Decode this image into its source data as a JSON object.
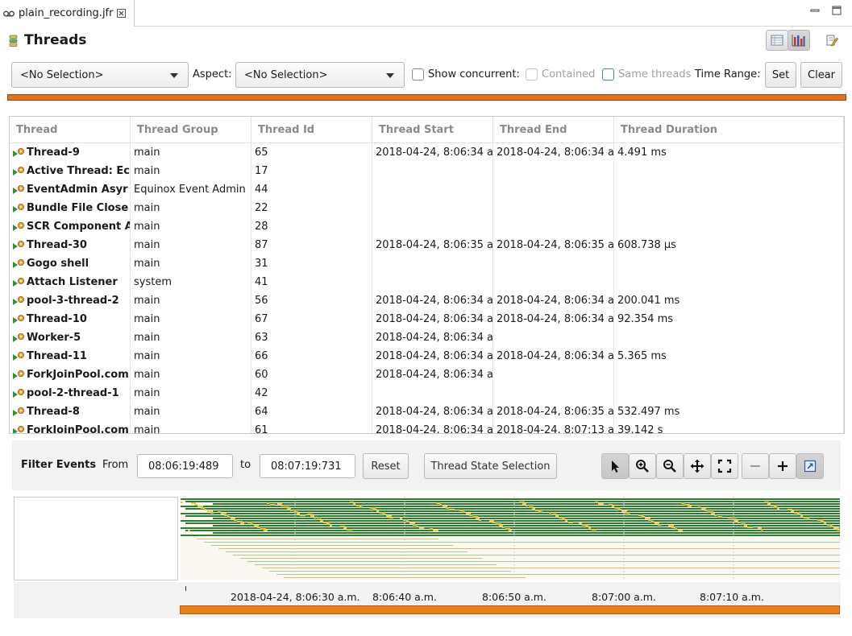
{
  "editor_tab": {
    "title": "plain_recording.jfr"
  },
  "page": {
    "title": "Threads"
  },
  "toolbar": {
    "selection_combo": "<No Selection>",
    "aspect_label": "Aspect:",
    "aspect_combo": "<No Selection>",
    "show_concurrent_label": "Show concurrent:",
    "contained_label": "Contained",
    "same_threads_label": "Same threads",
    "time_range_label": "Time Range:",
    "set_button": "Set",
    "clear_button": "Clear"
  },
  "table": {
    "columns": [
      "Thread",
      "Thread Group",
      "Thread Id",
      "Thread Start",
      "Thread End",
      "Thread Duration"
    ],
    "rows": [
      [
        "Thread-9",
        "main",
        "65",
        "2018-04-24, 8:06:34 a",
        "2018-04-24, 8:06:34 a",
        "4.491  ms"
      ],
      [
        "Active Thread: Ec",
        "main",
        "17",
        "",
        "",
        ""
      ],
      [
        "EventAdmin Asyr",
        "Equinox Event Admin",
        "44",
        "",
        "",
        ""
      ],
      [
        "Bundle File Close",
        "main",
        "22",
        "",
        "",
        ""
      ],
      [
        "SCR Component A",
        "main",
        "28",
        "",
        "",
        ""
      ],
      [
        "Thread-30",
        "main",
        "87",
        "2018-04-24, 8:06:35 a",
        "2018-04-24, 8:06:35 a",
        "608.738  µs"
      ],
      [
        "Gogo shell",
        "main",
        "31",
        "",
        "",
        ""
      ],
      [
        "Attach Listener",
        "system",
        "41",
        "",
        "",
        ""
      ],
      [
        "pool-3-thread-2",
        "main",
        "56",
        "2018-04-24, 8:06:34 a",
        "2018-04-24, 8:06:34 a",
        "200.041  ms"
      ],
      [
        "Thread-10",
        "main",
        "67",
        "2018-04-24, 8:06:34 a",
        "2018-04-24, 8:06:34 a",
        "92.354  ms"
      ],
      [
        "Worker-5",
        "main",
        "63",
        "2018-04-24, 8:06:34 a",
        "",
        ""
      ],
      [
        "Thread-11",
        "main",
        "66",
        "2018-04-24, 8:06:34 a",
        "2018-04-24, 8:06:34 a",
        "5.365  ms"
      ],
      [
        "ForkJoinPool.com",
        "main",
        "60",
        "2018-04-24, 8:06:34 a",
        "",
        ""
      ],
      [
        "pool-2-thread-1",
        "main",
        "42",
        "",
        "",
        ""
      ],
      [
        "Thread-8",
        "main",
        "64",
        "2018-04-24, 8:06:34 a",
        "2018-04-24, 8:06:35 a",
        "532.497  ms"
      ],
      [
        "ForkJoinPool.com",
        "main",
        "61",
        "2018-04-24, 8:06:34 a",
        "2018-04-24, 8:07:13 a",
        "39.142  s"
      ]
    ]
  },
  "filter": {
    "label": "Filter Events",
    "from_label": "From",
    "from_value": "08:06:19:489",
    "to_label": "to",
    "to_value": "08:07:19:731",
    "reset_button": "Reset",
    "thread_state_button": "Thread State Selection"
  },
  "tools": [
    "pointer-icon",
    "zoom-in-icon",
    "zoom-out-icon",
    "pan-icon",
    "fit-icon",
    "minus-icon",
    "plus-icon",
    "export-icon"
  ],
  "timeline_axis": {
    "ticks": [
      "2018-04-24, 8:06:30 a.m.",
      "8:06:40 a.m.",
      "8:06:50 a.m.",
      "8:07:00 a.m.",
      "8:07:10 a.m."
    ]
  },
  "colors": {
    "accent_orange": "#e8701c",
    "thread_green": "#2e7d32",
    "thread_yellow": "#e6c84a"
  }
}
